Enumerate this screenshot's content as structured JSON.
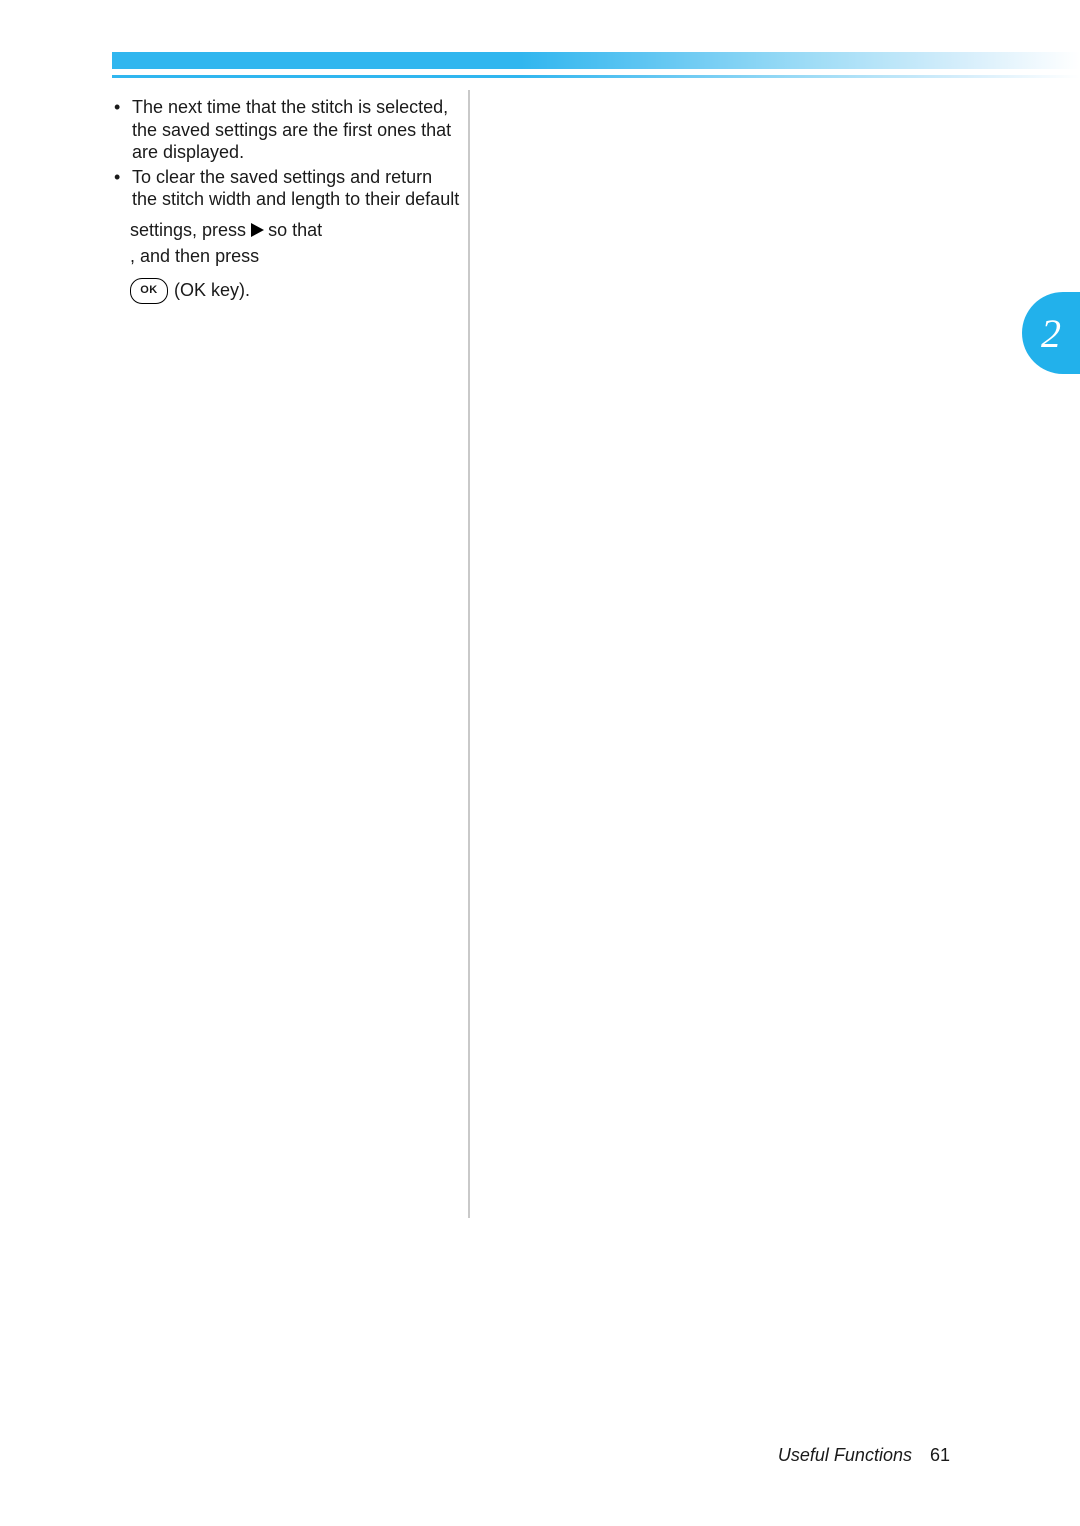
{
  "bullets": {
    "b1": "The next time that the stitch is selected, the saved settings are the first ones that are displayed.",
    "b2": "To clear the saved settings and return the stitch width and length to their default"
  },
  "inline": {
    "settings_press": "settings, press",
    "so_that": "so that",
    "and_then_press": ", and then press",
    "ok_label": "OK",
    "ok_key": "(OK key)."
  },
  "chapter_tab": "2",
  "footer": {
    "title": "Useful Functions",
    "page": "61"
  }
}
